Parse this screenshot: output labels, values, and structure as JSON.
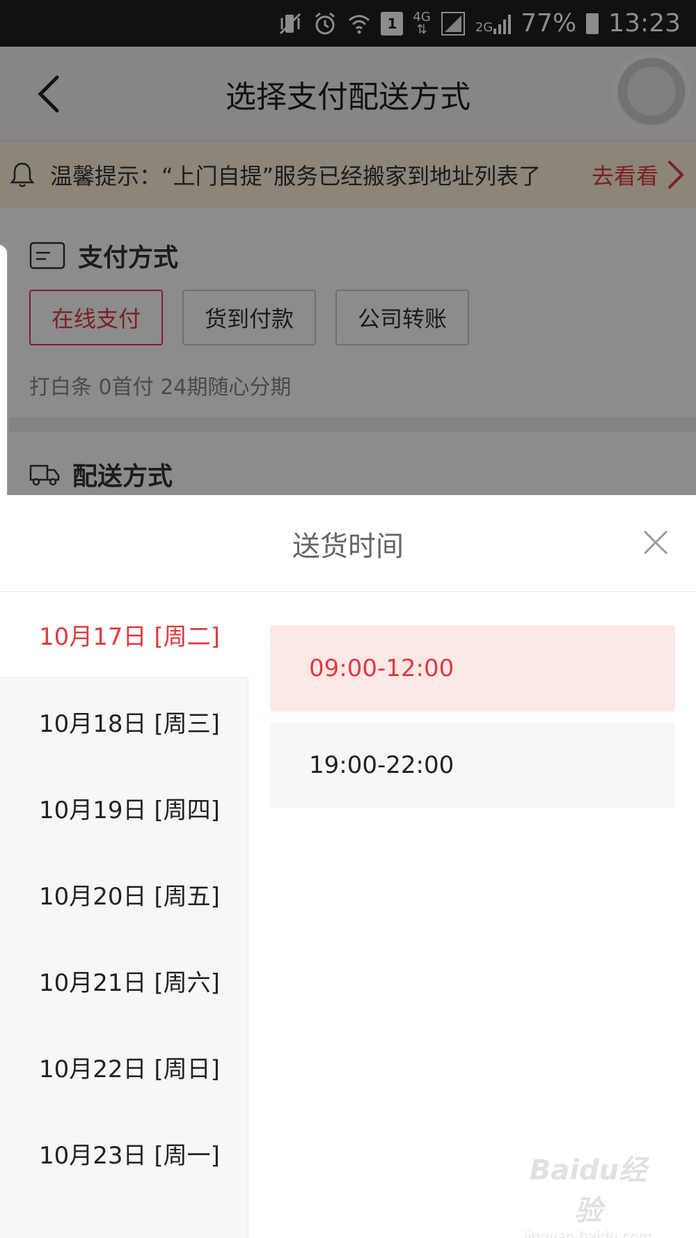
{
  "status_bar": {
    "sim_slot": "1",
    "network_label": "4G",
    "secondary_network": "2G",
    "battery": "77%",
    "time": "13:23"
  },
  "header": {
    "title": "选择支付配送方式"
  },
  "notice": {
    "text": "温馨提示：“上门自提”服务已经搬家到地址列表了",
    "link": "去看看"
  },
  "payment": {
    "title": "支付方式",
    "options": [
      "在线支付",
      "货到付款",
      "公司转账"
    ],
    "selected_index": 0,
    "promo": "打白条 0首付 24期随心分期"
  },
  "shipping": {
    "title": "配送方式"
  },
  "delivery_sheet": {
    "title": "送货时间",
    "dates": [
      "10月17日 [周二]",
      "10月18日 [周三]",
      "10月19日 [周四]",
      "10月20日 [周五]",
      "10月21日 [周六]",
      "10月22日 [周日]",
      "10月23日 [周一]"
    ],
    "selected_date_index": 0,
    "slots": [
      "09:00-12:00",
      "19:00-22:00"
    ],
    "selected_slot_index": 0
  },
  "watermark": {
    "logo": "Baidu经验",
    "url": "jingyan.baidu.com"
  },
  "colors": {
    "accent": "#e4393c",
    "notice_bg": "#fff3df",
    "selected_slot_bg": "#fde8e8"
  }
}
